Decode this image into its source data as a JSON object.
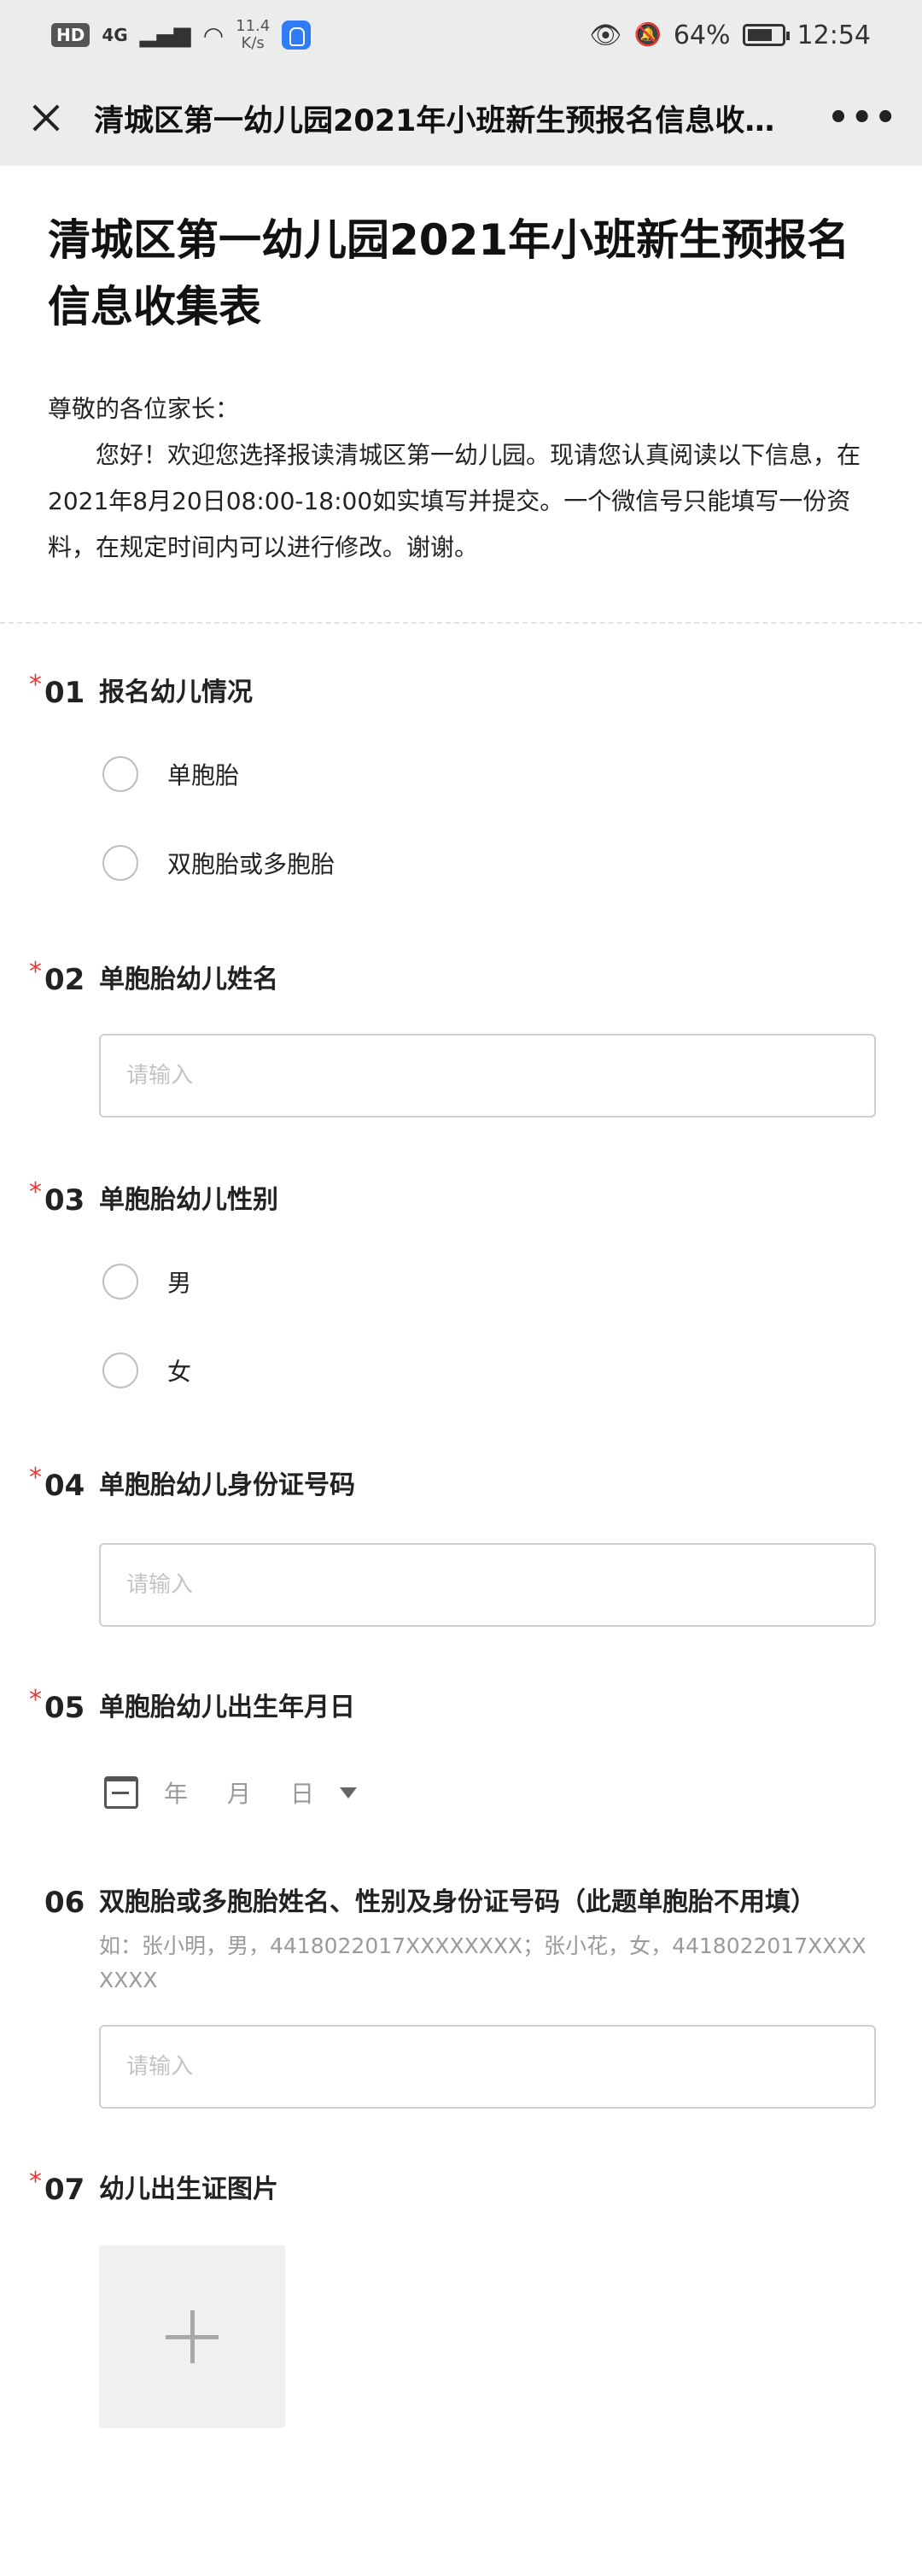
{
  "status_bar": {
    "hd": "HD",
    "network": "4G",
    "speed_value": "11.4",
    "speed_unit": "K/s",
    "battery": "64%",
    "time": "12:54"
  },
  "nav": {
    "title": "清城区第一幼儿园2021年小班新生预报名信息收…",
    "more": "•••"
  },
  "form": {
    "title": "清城区第一幼儿园2021年小班新生预报名信息收集表",
    "greeting": "尊敬的各位家长：",
    "intro": "您好！欢迎您选择报读清城区第一幼儿园。现请您认真阅读以下信息，在2021年8月20日08:00-18:00如实填写并提交。一个微信号只能填写一份资料，在规定时间内可以进行修改。谢谢。"
  },
  "questions": {
    "q1": {
      "num": "01",
      "title": "报名幼儿情况",
      "options": [
        "单胞胎",
        "双胞胎或多胞胎"
      ]
    },
    "q2": {
      "num": "02",
      "title": "单胞胎幼儿姓名",
      "placeholder": "请输入"
    },
    "q3": {
      "num": "03",
      "title": "单胞胎幼儿性别",
      "options": [
        "男",
        "女"
      ]
    },
    "q4": {
      "num": "04",
      "title": "单胞胎幼儿身份证号码",
      "placeholder": "请输入"
    },
    "q5": {
      "num": "05",
      "title": "单胞胎幼儿出生年月日",
      "year": "年",
      "month": "月",
      "day": "日"
    },
    "q6": {
      "num": "06",
      "title": "双胞胎或多胞胎姓名、性别及身份证号码（此题单胞胎不用填）",
      "hint": "如：张小明，男，4418022017XXXXXXXX；张小花，女，4418022017XXXXXXXX",
      "placeholder": "请输入"
    },
    "q7": {
      "num": "07",
      "title": "幼儿出生证图片"
    }
  },
  "required_mark": "*",
  "colors": {
    "required": "#e53935",
    "bar": "#ececec"
  }
}
